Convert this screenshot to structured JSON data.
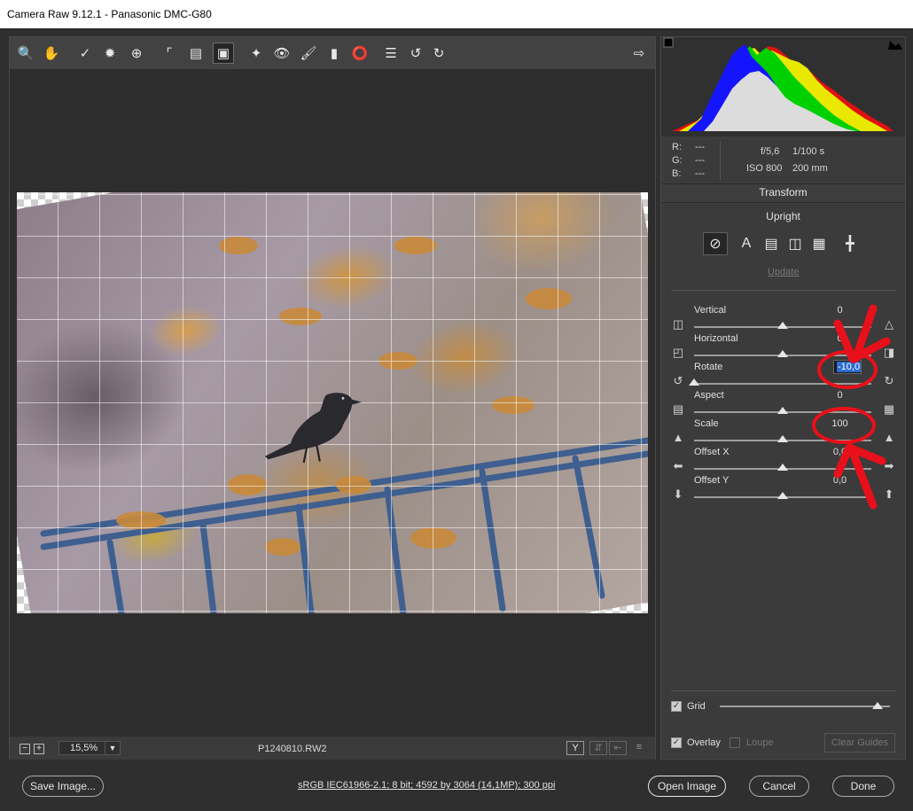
{
  "window": {
    "title": "Camera Raw 9.12.1  -  Panasonic DMC-G80"
  },
  "toolbar": {
    "tools": [
      "zoom-icon",
      "hand-icon",
      "white-balance-icon",
      "color-sampler-icon",
      "targeted-adjust-icon",
      "crop-icon",
      "straighten-icon",
      "transform-icon",
      "spot-removal-icon",
      "red-eye-icon",
      "adjustment-brush-icon",
      "graduated-filter-icon",
      "radial-filter-icon",
      "preferences-list-icon",
      "rotate-ccw-icon",
      "rotate-cw-icon"
    ],
    "active_tool": "transform-icon",
    "open_preview_icon": "fullscreen-icon"
  },
  "status": {
    "zoom_value": "15,5%",
    "filename": "P1240810.RW2"
  },
  "readout": {
    "r_label": "R:",
    "g_label": "G:",
    "b_label": "B:",
    "r_value": "---",
    "g_value": "---",
    "b_value": "---",
    "aperture": "f/5,6",
    "shutter": "1/100 s",
    "iso": "ISO 800",
    "focal": "200 mm"
  },
  "panel": {
    "title": "Transform",
    "upright_label": "Upright",
    "upright_buttons": [
      "off-icon",
      "auto-icon",
      "level-icon",
      "vertical-icon",
      "full-icon",
      "guided-icon"
    ],
    "update_label": "Update",
    "sliders": [
      {
        "label": "Vertical",
        "value": "0",
        "pos": 0.5
      },
      {
        "label": "Horizontal",
        "value": "0",
        "pos": 0.5
      },
      {
        "label": "Rotate",
        "value": "-10,0",
        "pos": 0.0
      },
      {
        "label": "Aspect",
        "value": "0",
        "pos": 0.5
      },
      {
        "label": "Scale",
        "value": "100",
        "pos": 0.5
      },
      {
        "label": "Offset X",
        "value": "0,0",
        "pos": 0.5
      },
      {
        "label": "Offset Y",
        "value": "0,0",
        "pos": 0.5
      }
    ],
    "grid_label": "Grid",
    "overlay_label": "Overlay",
    "loupe_label": "Loupe",
    "clear_guides_label": "Clear Guides"
  },
  "footer": {
    "save_label": "Save Image...",
    "workflow_label": "sRGB IEC61966-2.1; 8 bit; 4592 by 3064 (14,1MP); 300 ppi",
    "open_label": "Open Image",
    "cancel_label": "Cancel",
    "done_label": "Done"
  },
  "colors": {
    "annotation": "#e8101a",
    "accent": "#2b6cd1"
  }
}
